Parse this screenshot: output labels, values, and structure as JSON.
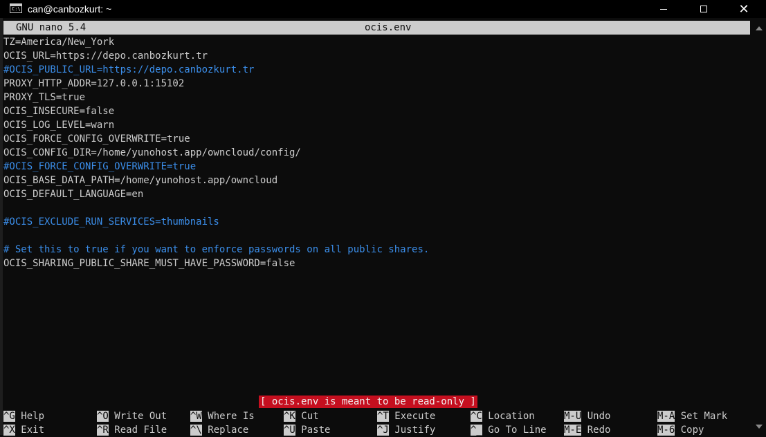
{
  "window": {
    "title": "can@canbozkurt: ~",
    "app_icon": "terminal-icon",
    "minimize_icon": "minimize-icon",
    "maximize_icon": "maximize-icon",
    "close_icon": "close-icon",
    "close_glyph": "✕"
  },
  "nano": {
    "version": "GNU nano 5.4",
    "filename": "ocis.env",
    "status_message": "[ ocis.env is meant to be read-only ]"
  },
  "editor": {
    "lines": [
      {
        "text": "TZ=America/New_York",
        "comment": false
      },
      {
        "text": "OCIS_URL=https://depo.canbozkurt.tr",
        "comment": false
      },
      {
        "text": "#OCIS_PUBLIC_URL=https://depo.canbozkurt.tr",
        "comment": true
      },
      {
        "text": "PROXY_HTTP_ADDR=127.0.0.1:15102",
        "comment": false
      },
      {
        "text": "PROXY_TLS=true",
        "comment": false
      },
      {
        "text": "OCIS_INSECURE=false",
        "comment": false
      },
      {
        "text": "OCIS_LOG_LEVEL=warn",
        "comment": false
      },
      {
        "text": "OCIS_FORCE_CONFIG_OVERWRITE=true",
        "comment": false
      },
      {
        "text": "OCIS_CONFIG_DIR=/home/yunohost.app/owncloud/config/",
        "comment": false
      },
      {
        "text": "#OCIS_FORCE_CONFIG_OVERWRITE=true",
        "comment": true
      },
      {
        "text": "OCIS_BASE_DATA_PATH=/home/yunohost.app/owncloud",
        "comment": false
      },
      {
        "text": "OCIS_DEFAULT_LANGUAGE=en",
        "comment": false
      },
      {
        "text": "",
        "comment": false
      },
      {
        "text": "#OCIS_EXCLUDE_RUN_SERVICES=thumbnails",
        "comment": true
      },
      {
        "text": "",
        "comment": false
      },
      {
        "text": "# Set this to true if you want to enforce passwords on all public shares.",
        "comment": true
      },
      {
        "text": "OCIS_SHARING_PUBLIC_SHARE_MUST_HAVE_PASSWORD=false",
        "comment": false
      }
    ]
  },
  "shortcuts": {
    "row1": [
      {
        "key": "^G",
        "label": "Help"
      },
      {
        "key": "^O",
        "label": "Write Out"
      },
      {
        "key": "^W",
        "label": "Where Is"
      },
      {
        "key": "^K",
        "label": "Cut"
      },
      {
        "key": "^T",
        "label": "Execute"
      },
      {
        "key": "^C",
        "label": "Location"
      },
      {
        "key": "M-U",
        "label": "Undo"
      },
      {
        "key": "M-A",
        "label": "Set Mark"
      }
    ],
    "row2": [
      {
        "key": "^X",
        "label": "Exit"
      },
      {
        "key": "^R",
        "label": "Read File"
      },
      {
        "key": "^\\",
        "label": "Replace"
      },
      {
        "key": "^U",
        "label": "Paste"
      },
      {
        "key": "^J",
        "label": "Justify"
      },
      {
        "key": "^_",
        "label": "Go To Line"
      },
      {
        "key": "M-E",
        "label": "Redo"
      },
      {
        "key": "M-6",
        "label": "Copy"
      }
    ]
  },
  "colors": {
    "background": "#0c0c0c",
    "text": "#cccccc",
    "comment": "#3b8eea",
    "header_bg": "#cccccc",
    "status_bg": "#c50f1f"
  }
}
